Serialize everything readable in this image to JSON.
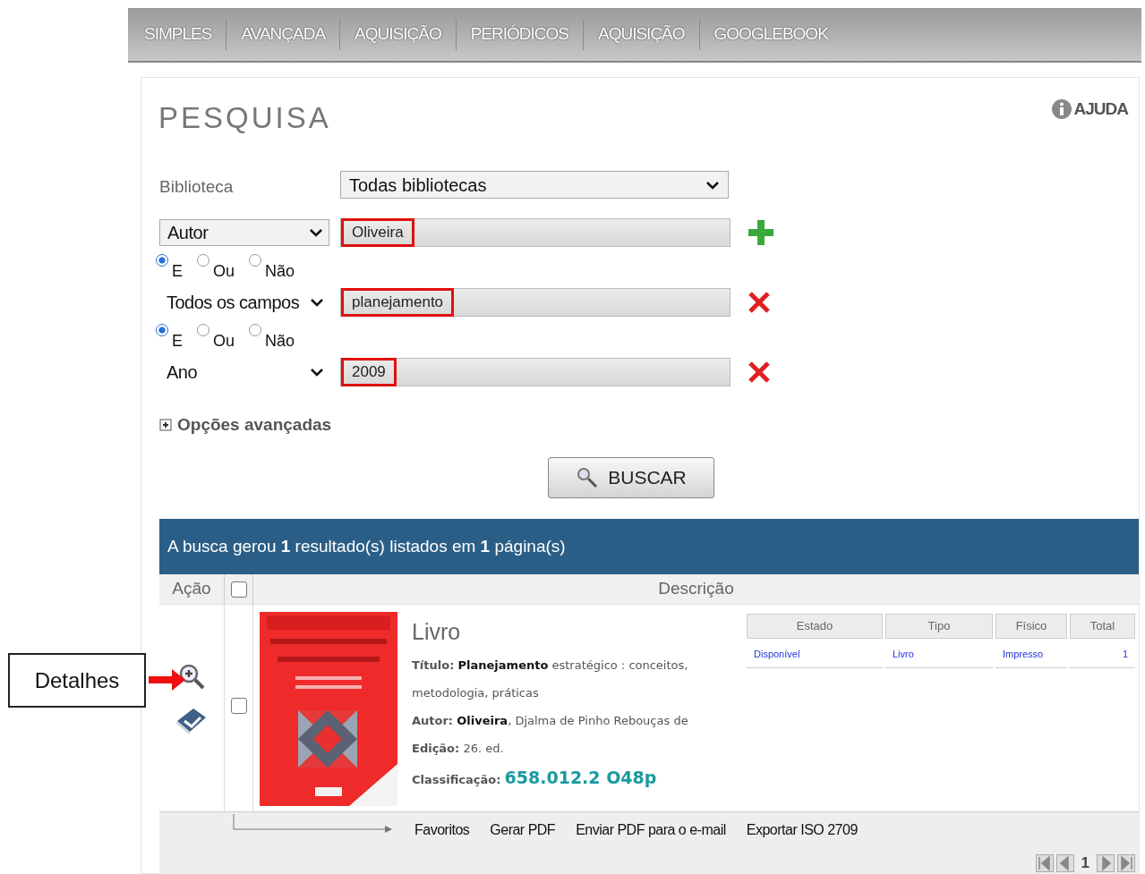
{
  "nav": {
    "tabs": [
      {
        "label": "SIMPLES",
        "selected": false
      },
      {
        "label": "AVANÇADA",
        "selected": false
      },
      {
        "label": "AQUISIÇÃO",
        "selected": false
      },
      {
        "label": "PERIÓDICOS",
        "selected": false
      },
      {
        "label": "AQUISIÇÃO",
        "selected": false
      },
      {
        "label": "GOOGLEBOOK",
        "selected": false
      }
    ]
  },
  "page_title": "PESQUISA",
  "help": "AJUDA",
  "library": {
    "label": "Biblioteca",
    "value": "Todas bibliotecas"
  },
  "search_rows": [
    {
      "field": "Autor",
      "value": "Oliveira",
      "highlighted": true,
      "kind": "add"
    },
    {
      "operators": [
        {
          "label": "E",
          "selected": true
        },
        {
          "label": "Ou",
          "selected": false
        },
        {
          "label": "Não",
          "selected": false
        }
      ],
      "field": "Todos os campos",
      "value": "planejamento",
      "highlighted": true,
      "kind": "remove"
    },
    {
      "operators": [
        {
          "label": "E",
          "selected": true
        },
        {
          "label": "Ou",
          "selected": false
        },
        {
          "label": "Não",
          "selected": false
        }
      ],
      "field": "Ano",
      "value": "2009",
      "highlighted": true,
      "kind": "remove"
    }
  ],
  "advanced_options": {
    "label": "Opções avançadas",
    "expanded": false
  },
  "search_button": "BUSCAR",
  "results": {
    "summary": "A busca gerou **1** resultado(s) listados em **1** página(s)",
    "columns": [
      "Ação",
      "Descrição"
    ],
    "all_checked": false,
    "items": [
      {
        "checked": false,
        "type": "Livro",
        "fields": [
          {
            "label": "Título:",
            "value": "**Planejamento** estratégico : conceitos, metodologia, práticas"
          },
          {
            "label": "Autor:",
            "value": "**Oliveira**, Djalma de Pinho Rebouças de"
          },
          {
            "label": "Edição:",
            "value": "26. ed."
          }
        ],
        "classification": {
          "label": "Classificação:",
          "value": "658.012.2 O48p"
        },
        "holdings": {
          "columns": [
            "Estado",
            "Tipo",
            "Físico",
            "Total"
          ],
          "row": [
            "Disponível",
            "Livro",
            "Impresso",
            "1"
          ]
        }
      }
    ],
    "actions": [
      "Favoritos",
      "Gerar PDF",
      "Enviar PDF para o e-mail",
      "Exportar ISO 2709"
    ],
    "page": "1"
  },
  "callout": "Detalhes"
}
